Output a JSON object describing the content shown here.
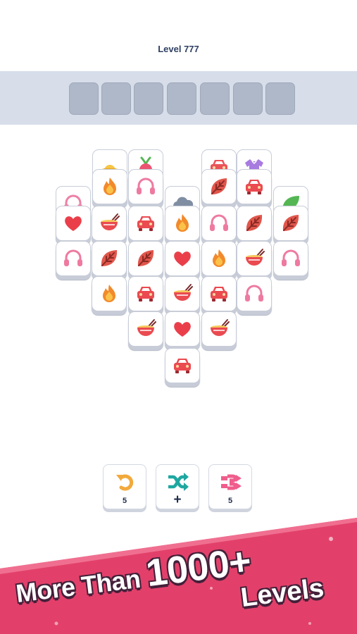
{
  "header": {
    "level_label": "Level 777"
  },
  "tray": {
    "slot_count": 7,
    "filled": 0
  },
  "board": {
    "rows": [
      {
        "layer": "back",
        "tiles": [
          "sun-hat",
          "radish",
          "car",
          "purple-shirt"
        ]
      },
      {
        "layer": "top",
        "tiles": [
          "fire",
          "headphones",
          "leaf",
          "car"
        ]
      },
      {
        "layer": "back",
        "tiles": [
          "headphones",
          "cloud",
          "green-leaf"
        ]
      },
      {
        "layer": "top",
        "tiles": [
          "heart",
          "noodle-bowl",
          "car",
          "fire",
          "headphones",
          "leaf",
          "leaf"
        ]
      },
      {
        "layer": "top",
        "tiles": [
          "headphones",
          "leaf",
          "leaf",
          "heart",
          "fire",
          "noodle-bowl",
          "headphones"
        ]
      },
      {
        "layer": "top",
        "tiles": [
          "fire",
          "car",
          "noodle-bowl",
          "car",
          "headphones"
        ]
      },
      {
        "layer": "top",
        "tiles": [
          "noodle-bowl",
          "heart",
          "noodle-bowl"
        ]
      },
      {
        "layer": "top",
        "tiles": [
          "car"
        ]
      }
    ]
  },
  "tools": [
    {
      "icon": "undo-icon",
      "count": "5",
      "color": "#f2a93b"
    },
    {
      "icon": "shuffle-icon",
      "count": "+",
      "color": "#1ea7a0"
    },
    {
      "icon": "magnet-icon",
      "count": "5",
      "color": "#ef5e8c"
    }
  ],
  "promo": {
    "line1_text": "More Than",
    "line1_number": "1000+",
    "line2": "Levels"
  },
  "colors": {
    "banner": "#e2406a",
    "banner_dark": "#c42c58",
    "outline": "#44203a"
  }
}
